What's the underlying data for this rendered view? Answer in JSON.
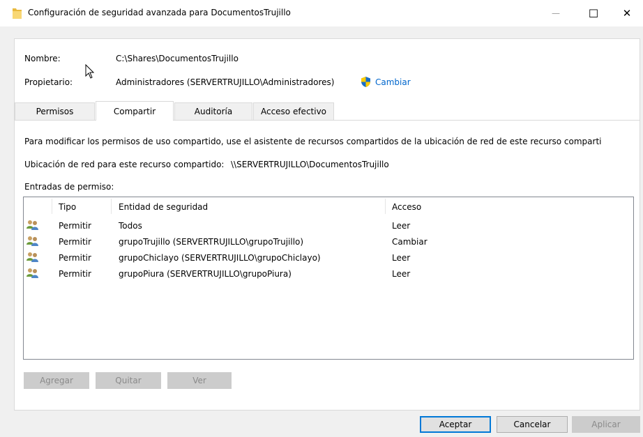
{
  "window": {
    "title": "Configuración de seguridad avanzada para DocumentosTrujillo",
    "minimize_glyph": "—",
    "maximize_glyph": "☐",
    "close_glyph": "✕"
  },
  "info": {
    "name_label": "Nombre:",
    "name_value": "C:\\Shares\\DocumentosTrujillo",
    "owner_label": "Propietario:",
    "owner_value": "Administradores (SERVERTRUJILLO\\Administradores)",
    "change_link": "Cambiar"
  },
  "tabs": [
    {
      "label": "Permisos"
    },
    {
      "label": "Compartir"
    },
    {
      "label": "Auditoría"
    },
    {
      "label": "Acceso efectivo"
    }
  ],
  "share": {
    "description": "Para modificar los permisos de uso compartido, use el asistente de recursos compartidos de la ubicación de red de este recurso comparti",
    "network_location_label": "Ubicación de red para este recurso compartido:",
    "network_location_value": "\\\\SERVERTRUJILLO\\DocumentosTrujillo",
    "entries_label": "Entradas de permiso:"
  },
  "table": {
    "headers": [
      "Tipo",
      "Entidad de seguridad",
      "Acceso"
    ],
    "rows": [
      {
        "type": "Permitir",
        "principal": "Todos",
        "access": "Leer"
      },
      {
        "type": "Permitir",
        "principal": "grupoTrujillo (SERVERTRUJILLO\\grupoTrujillo)",
        "access": "Cambiar"
      },
      {
        "type": "Permitir",
        "principal": "grupoChiclayo (SERVERTRUJILLO\\grupoChiclayo)",
        "access": "Leer"
      },
      {
        "type": "Permitir",
        "principal": "grupoPiura (SERVERTRUJILLO\\grupoPiura)",
        "access": "Leer"
      }
    ]
  },
  "list_buttons": {
    "add": "Agregar",
    "remove": "Quitar",
    "view": "Ver"
  },
  "dialog_buttons": {
    "ok": "Aceptar",
    "cancel": "Cancelar",
    "apply": "Aplicar"
  },
  "icons": {
    "title": "folder-icon",
    "owner_change": "uac-shield-icon",
    "row": "user-group-icon"
  },
  "colors": {
    "link": "#0066cc",
    "accent": "#0078d7",
    "folder": "#f8d775"
  }
}
